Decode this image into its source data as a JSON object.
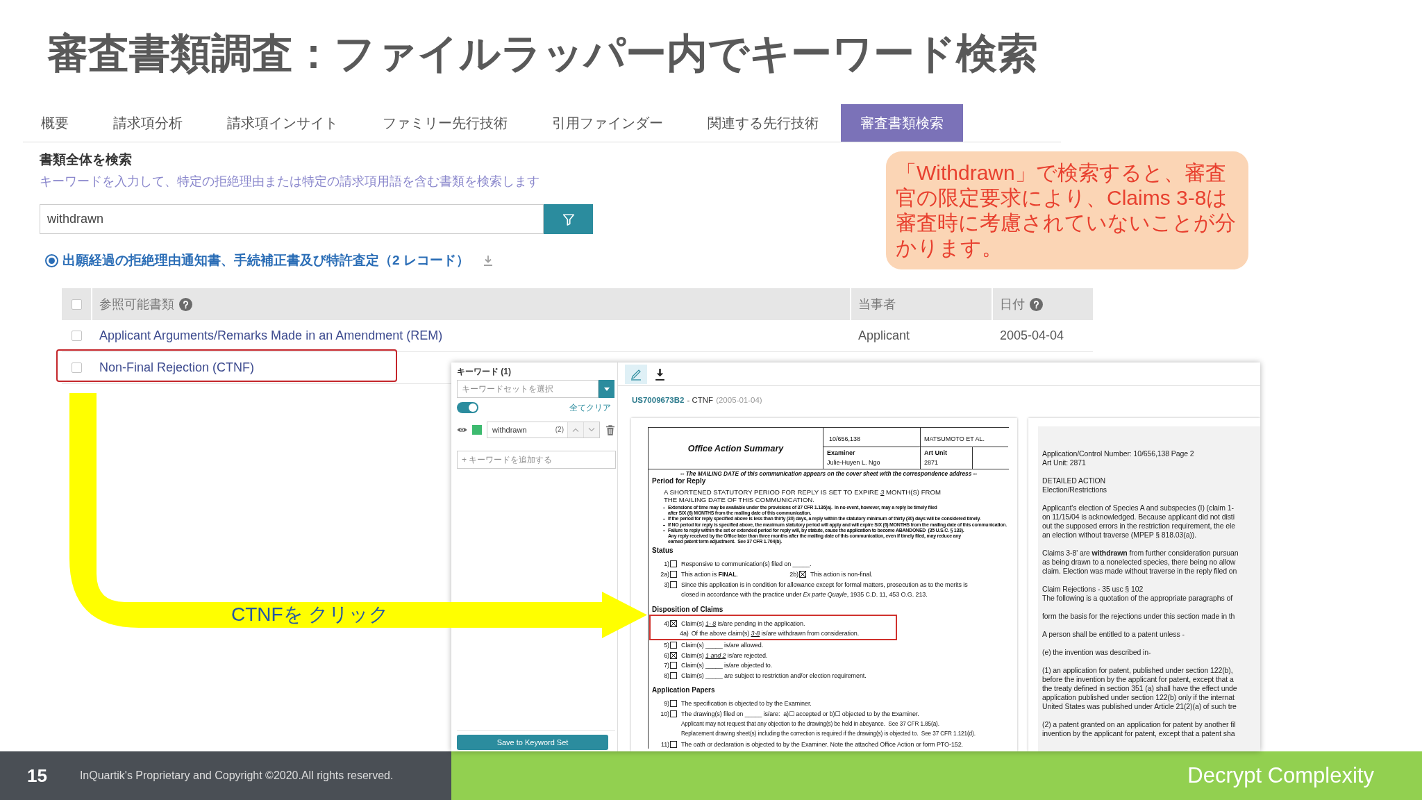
{
  "slide_title": "審査書類調査：ファイルラッパー内でキーワード検索",
  "tabs": [
    {
      "label": "概要",
      "selected": false
    },
    {
      "label": "請求項分析",
      "selected": false
    },
    {
      "label": "請求項インサイト",
      "selected": false
    },
    {
      "label": "ファミリー先行技術",
      "selected": false
    },
    {
      "label": "引用ファインダー",
      "selected": false
    },
    {
      "label": "関連する先行技術",
      "selected": false
    },
    {
      "label": "審査書類検索",
      "selected": true
    }
  ],
  "search_section": {
    "heading": "書類全体を検索",
    "hint": "キーワードを入力して、特定の拒絶理由または特定の請求項用語を含む書類を検索します",
    "search": {
      "value": "withdrawn"
    }
  },
  "result_group": {
    "selected": true,
    "label": "出願経過の拒絶理由通知書、手続補正書及び特許査定（2 レコード）"
  },
  "callout": {
    "text": "「Withdrawn」で検索すると、審査官の限定要求により、Claims 3-8は審査時に考慮されていないことが分かります。"
  },
  "table": {
    "all_checked": false,
    "columns": [
      {
        "label": "参照可能書類",
        "help": true
      },
      {
        "label": "当事者",
        "help": false
      },
      {
        "label": "日付",
        "help": true
      }
    ],
    "rows": [
      {
        "checked": false,
        "document": "Applicant Arguments/Remarks Made in an Amendment (REM)",
        "party": "Applicant",
        "date": "2005-04-04",
        "framed": false
      },
      {
        "checked": false,
        "document": "Non-Final Rejection (CTNF)",
        "framed": true
      }
    ]
  },
  "arrow_annotation": {
    "label": "CTNFを クリック"
  },
  "keyword_panel": {
    "title": "キーワード (1)",
    "keyword_set": {
      "placeholder": "キーワードセットを選択"
    },
    "highlight_on": true,
    "clear_all": "全てクリア",
    "keywords": [
      {
        "color": "#3dba6f",
        "term": "withdrawn",
        "count": "(2)"
      }
    ],
    "add_keyword": {
      "placeholder": "+ キーワードを追加する"
    },
    "save_button": "Save to Keyword Set"
  },
  "document_viewer": {
    "highlight_tool_active": true,
    "document_id": "US7009673B2",
    "document_type": "- CTNF",
    "document_date": "(2005-01-04)",
    "office_action_page": {
      "form_title": "Office Action Summary",
      "application_number": "10/656,138",
      "applicant": "MATSUMOTO ET AL.",
      "examiner_label": "Examiner",
      "examiner": "Julie-Huyen L. Ngo",
      "art_unit_label": "Art Unit",
      "art_unit": "2871",
      "mailing_notice": "-- The MAILING DATE of this communication appears on the cover sheet with the correspondence address --",
      "period_for_reply": {
        "heading": "Period for Reply",
        "lead": "A SHORTENED STATUTORY PERIOD FOR REPLY IS SET TO EXPIRE",
        "fill": "3",
        "text": "MONTH(S) FROM\nTHE MAILING DATE OF THIS COMMUNICATION.",
        "bullets": [
          "Extensions of time may be available under the provisions of 37 CFR 1.136(a).  In no event, however, may a reply be timely filed\nafter SIX (6) MONTHS from the mailing date of this communication.",
          "If the period for reply specified above is less than thirty (30) days, a reply within the statutory minimum of thirty (30) days will be considered timely.",
          "If NO period for reply is specified above, the maximum statutory period will apply and will expire SIX (6) MONTHS from the mailing date of this communication.",
          "Failure to reply within the set or extended period for reply will, by statute, cause the application to become ABANDONED  (35 U.S.C. § 133).\nAny reply received by the Office later than three months after the mailing date of this communication, even if timely filed, may reduce any\nearned patent term adjustment.  See 37 CFR 1.704(b)."
        ]
      },
      "status": {
        "heading": "Status",
        "rows": [
          {
            "items": [
              {
                "kind": "checkbox",
                "number": "1)",
                "checked": false,
                "text": "Responsive to communication(s) filed on _____."
              }
            ]
          },
          {
            "items": [
              {
                "kind": "checkbox",
                "number": "2a)",
                "checked": false,
                "text": "This action is **FINAL**."
              },
              {
                "kind": "checkbox",
                "number": "2b)",
                "checked": true,
                "text": "This action is non-final."
              }
            ]
          },
          {
            "items": [
              {
                "kind": "checkbox",
                "number": "3)",
                "checked": false,
                "text": "Since this application is in condition for allowance except for formal matters, prosecution as to the merits is\nclosed in accordance with the practice under *Ex parte Quayle*, 1935 C.D. 11, 453 O.G. 213."
              }
            ]
          }
        ]
      },
      "disposition": {
        "heading": "Disposition of Claims",
        "groups": [
          {
            "framed": true,
            "rows": [
              {
                "items": [
                  {
                    "kind": "checkbox",
                    "number": "4)",
                    "checked": true,
                    "lead": "Claim(s)",
                    "fill": "1- 8",
                    "text": "is/are pending in the application."
                  }
                ]
              },
              {
                "items": [
                  {
                    "kind": "sub",
                    "number": "4a)",
                    "lead": "Of the above claim(s)",
                    "fill": "3-8",
                    "text": "is/are withdrawn from consideration."
                  }
                ]
              }
            ]
          },
          {
            "framed": false,
            "rows": [
              {
                "items": [
                  {
                    "kind": "checkbox",
                    "number": "5)",
                    "checked": false,
                    "text": "Claim(s) _____ is/are allowed."
                  }
                ]
              },
              {
                "items": [
                  {
                    "kind": "checkbox",
                    "number": "6)",
                    "checked": true,
                    "lead": "Claim(s)",
                    "fill": "1 and 2",
                    "text": "is/are rejected."
                  }
                ]
              },
              {
                "items": [
                  {
                    "kind": "checkbox",
                    "number": "7)",
                    "checked": false,
                    "text": "Claim(s) _____ is/are objected to."
                  }
                ]
              },
              {
                "items": [
                  {
                    "kind": "checkbox",
                    "number": "8)",
                    "checked": false,
                    "text": "Claim(s) _____ are subject to restriction and/or election requirement."
                  }
                ]
              }
            ]
          }
        ]
      },
      "application_papers": {
        "heading": "Application Papers",
        "rows": [
          {
            "items": [
              {
                "kind": "checkbox",
                "number": "9)",
                "checked": false,
                "text": "The specification is objected to by the Examiner."
              }
            ]
          },
          {
            "items": [
              {
                "kind": "checkbox",
                "number": "10)",
                "checked": false,
                "text": "The drawing(s) filed on _____ is/are:  a)☐ accepted or b)☐ objected to by the Examiner."
              }
            ]
          },
          {
            "items": [
              {
                "kind": "note",
                "text": "Applicant may not request that any objection to the drawing(s) be held in abeyance.  See 37 CFR 1.85(a)."
              }
            ]
          },
          {
            "items": [
              {
                "kind": "note",
                "text": "Replacement drawing sheet(s) including the correction is required if the drawing(s) is objected to.  See 37 CFR 1.121(d)."
              }
            ]
          },
          {
            "items": [
              {
                "kind": "checkbox",
                "number": "11)",
                "checked": false,
                "text": "The oath or declaration is objected to by the Examiner. Note the attached Office Action or form PTO-152."
              }
            ]
          }
        ]
      }
    },
    "detail_page": {
      "paragraphs": [
        "Application/Control Number: 10/656,138 Page 2\nArt Unit: 2871",
        "DETAILED ACTION\nElection/Restrictions",
        "Applicant's election of Species A and subspecies (I) (claim 1-\non 11/15/04 is acknowledged. Because applicant did not disti\nout the supposed errors in the restriction requirement, the ele\nan election without traverse (MPEP § 818.03(a)).",
        "Claims 3-8' are **withdrawn** from further consideration pursuan\nas being drawn to a nonelected species, there being no allow\nclaim. Election was made without traverse in the reply filed on",
        "Claim Rejections - 35 usc § 102\nThe following is a quotation of the appropriate paragraphs of",
        "form the basis for the rejections under this section made in th",
        "A person shall be entitled to a patent unless -",
        "(e) the invention was described in-",
        "(1) an application for patent, published under section 122(b),\nbefore the invention by the applicant for patent, except that a\nthe treaty defined in section 351 (a) shall have the effect unde\napplication published under section 122(b) only if the internat\nUnited States was published under Article 21(2)(a) of such tre",
        "(2) a patent granted on an application for patent by another fil\ninvention by the applicant for patent, except that a patent sha"
      ]
    }
  },
  "footer": {
    "page_number": "15",
    "copyright": "InQuartik's Proprietary and Copyright ©2020.All rights reserved.",
    "tagline": "Decrypt Complexity"
  }
}
